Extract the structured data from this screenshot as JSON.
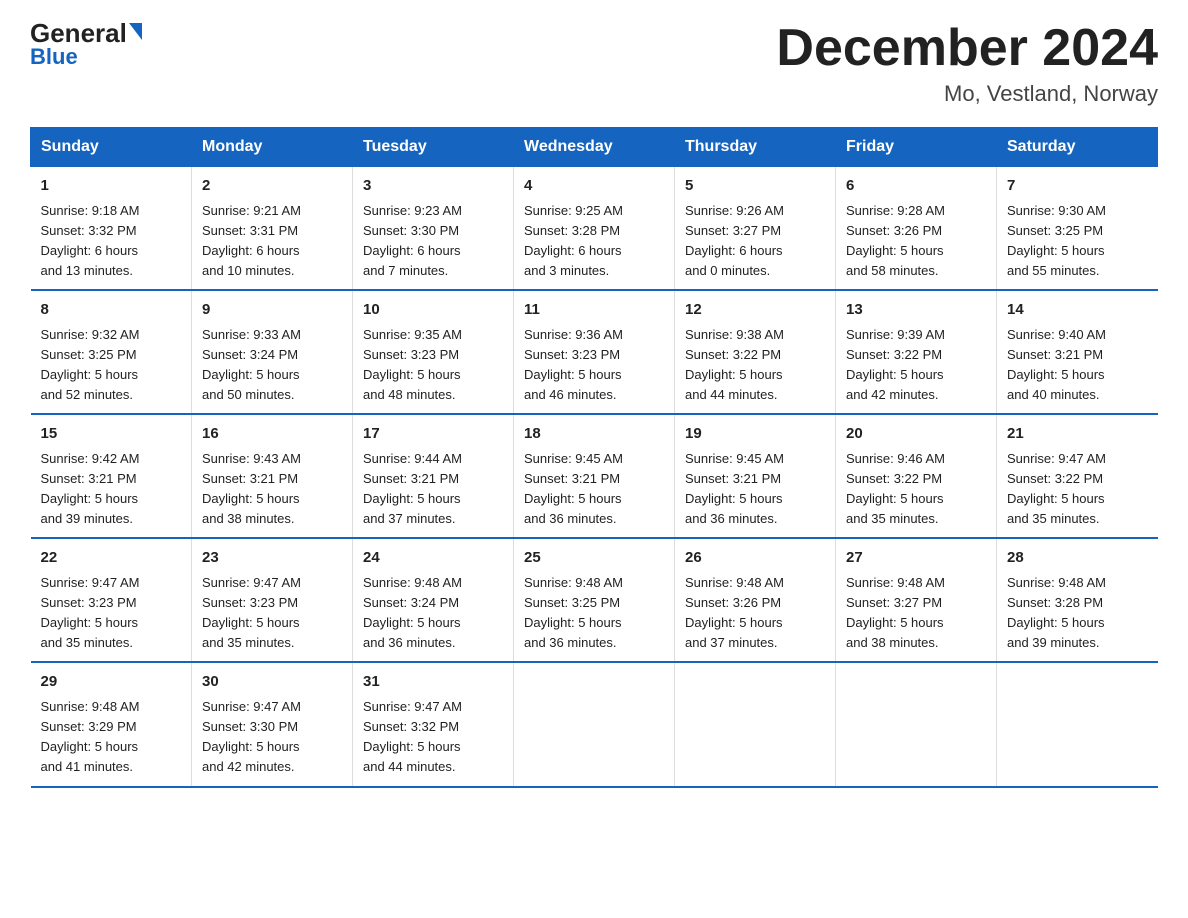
{
  "header": {
    "logo_general": "General",
    "logo_blue": "Blue",
    "main_title": "December 2024",
    "subtitle": "Mo, Vestland, Norway"
  },
  "days_of_week": [
    "Sunday",
    "Monday",
    "Tuesday",
    "Wednesday",
    "Thursday",
    "Friday",
    "Saturday"
  ],
  "weeks": [
    [
      {
        "day": "1",
        "sunrise": "9:18 AM",
        "sunset": "3:32 PM",
        "daylight": "6 hours and 13 minutes."
      },
      {
        "day": "2",
        "sunrise": "9:21 AM",
        "sunset": "3:31 PM",
        "daylight": "6 hours and 10 minutes."
      },
      {
        "day": "3",
        "sunrise": "9:23 AM",
        "sunset": "3:30 PM",
        "daylight": "6 hours and 7 minutes."
      },
      {
        "day": "4",
        "sunrise": "9:25 AM",
        "sunset": "3:28 PM",
        "daylight": "6 hours and 3 minutes."
      },
      {
        "day": "5",
        "sunrise": "9:26 AM",
        "sunset": "3:27 PM",
        "daylight": "6 hours and 0 minutes."
      },
      {
        "day": "6",
        "sunrise": "9:28 AM",
        "sunset": "3:26 PM",
        "daylight": "5 hours and 58 minutes."
      },
      {
        "day": "7",
        "sunrise": "9:30 AM",
        "sunset": "3:25 PM",
        "daylight": "5 hours and 55 minutes."
      }
    ],
    [
      {
        "day": "8",
        "sunrise": "9:32 AM",
        "sunset": "3:25 PM",
        "daylight": "5 hours and 52 minutes."
      },
      {
        "day": "9",
        "sunrise": "9:33 AM",
        "sunset": "3:24 PM",
        "daylight": "5 hours and 50 minutes."
      },
      {
        "day": "10",
        "sunrise": "9:35 AM",
        "sunset": "3:23 PM",
        "daylight": "5 hours and 48 minutes."
      },
      {
        "day": "11",
        "sunrise": "9:36 AM",
        "sunset": "3:23 PM",
        "daylight": "5 hours and 46 minutes."
      },
      {
        "day": "12",
        "sunrise": "9:38 AM",
        "sunset": "3:22 PM",
        "daylight": "5 hours and 44 minutes."
      },
      {
        "day": "13",
        "sunrise": "9:39 AM",
        "sunset": "3:22 PM",
        "daylight": "5 hours and 42 minutes."
      },
      {
        "day": "14",
        "sunrise": "9:40 AM",
        "sunset": "3:21 PM",
        "daylight": "5 hours and 40 minutes."
      }
    ],
    [
      {
        "day": "15",
        "sunrise": "9:42 AM",
        "sunset": "3:21 PM",
        "daylight": "5 hours and 39 minutes."
      },
      {
        "day": "16",
        "sunrise": "9:43 AM",
        "sunset": "3:21 PM",
        "daylight": "5 hours and 38 minutes."
      },
      {
        "day": "17",
        "sunrise": "9:44 AM",
        "sunset": "3:21 PM",
        "daylight": "5 hours and 37 minutes."
      },
      {
        "day": "18",
        "sunrise": "9:45 AM",
        "sunset": "3:21 PM",
        "daylight": "5 hours and 36 minutes."
      },
      {
        "day": "19",
        "sunrise": "9:45 AM",
        "sunset": "3:21 PM",
        "daylight": "5 hours and 36 minutes."
      },
      {
        "day": "20",
        "sunrise": "9:46 AM",
        "sunset": "3:22 PM",
        "daylight": "5 hours and 35 minutes."
      },
      {
        "day": "21",
        "sunrise": "9:47 AM",
        "sunset": "3:22 PM",
        "daylight": "5 hours and 35 minutes."
      }
    ],
    [
      {
        "day": "22",
        "sunrise": "9:47 AM",
        "sunset": "3:23 PM",
        "daylight": "5 hours and 35 minutes."
      },
      {
        "day": "23",
        "sunrise": "9:47 AM",
        "sunset": "3:23 PM",
        "daylight": "5 hours and 35 minutes."
      },
      {
        "day": "24",
        "sunrise": "9:48 AM",
        "sunset": "3:24 PM",
        "daylight": "5 hours and 36 minutes."
      },
      {
        "day": "25",
        "sunrise": "9:48 AM",
        "sunset": "3:25 PM",
        "daylight": "5 hours and 36 minutes."
      },
      {
        "day": "26",
        "sunrise": "9:48 AM",
        "sunset": "3:26 PM",
        "daylight": "5 hours and 37 minutes."
      },
      {
        "day": "27",
        "sunrise": "9:48 AM",
        "sunset": "3:27 PM",
        "daylight": "5 hours and 38 minutes."
      },
      {
        "day": "28",
        "sunrise": "9:48 AM",
        "sunset": "3:28 PM",
        "daylight": "5 hours and 39 minutes."
      }
    ],
    [
      {
        "day": "29",
        "sunrise": "9:48 AM",
        "sunset": "3:29 PM",
        "daylight": "5 hours and 41 minutes."
      },
      {
        "day": "30",
        "sunrise": "9:47 AM",
        "sunset": "3:30 PM",
        "daylight": "5 hours and 42 minutes."
      },
      {
        "day": "31",
        "sunrise": "9:47 AM",
        "sunset": "3:32 PM",
        "daylight": "5 hours and 44 minutes."
      },
      null,
      null,
      null,
      null
    ]
  ],
  "labels": {
    "sunrise": "Sunrise:",
    "sunset": "Sunset:",
    "daylight": "Daylight:"
  }
}
